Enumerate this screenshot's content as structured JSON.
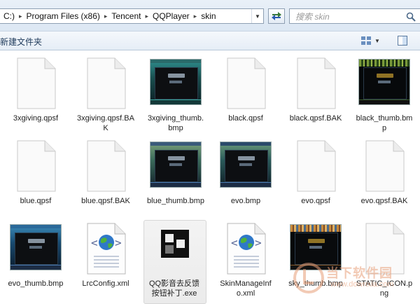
{
  "address": {
    "crumbs": [
      "C:)",
      "Program Files (x86)",
      "Tencent",
      "QQPlayer",
      "skin"
    ],
    "separator": "▸"
  },
  "search": {
    "placeholder": "搜索 skin"
  },
  "toolbar": {
    "new_folder_label": "新建文件夹"
  },
  "files": [
    {
      "name": "3xgiving.qpsf",
      "type": "doc"
    },
    {
      "name": "3xgiving.qpsf.BAK",
      "type": "doc"
    },
    {
      "name": "3xgiving_thumb.bmp",
      "type": "bmp-green"
    },
    {
      "name": "black.qpsf",
      "type": "doc"
    },
    {
      "name": "black.qpsf.BAK",
      "type": "doc"
    },
    {
      "name": "black_thumb.bmp",
      "type": "bmp-black"
    },
    {
      "name": "blue.qpsf",
      "type": "doc"
    },
    {
      "name": "blue.qpsf.BAK",
      "type": "doc"
    },
    {
      "name": "blue_thumb.bmp",
      "type": "bmp-green"
    },
    {
      "name": "evo.bmp",
      "type": "bmp-green"
    },
    {
      "name": "evo.qpsf",
      "type": "doc"
    },
    {
      "name": "evo.qpsf.BAK",
      "type": "doc"
    },
    {
      "name": "evo_thumb.bmp",
      "type": "bmp-blue"
    },
    {
      "name": "LrcConfig.xml",
      "type": "xml"
    },
    {
      "name": "QQ影音去反馈按钮补丁.exe",
      "type": "exe"
    },
    {
      "name": "SkinManageInfo.xml",
      "type": "xml"
    },
    {
      "name": "sky_thumb.bmp",
      "type": "bmp-sky"
    },
    {
      "name": "STATIC_ICON.png",
      "type": "doc"
    }
  ],
  "selected_file": "QQ影音去反馈按钮补丁.exe",
  "watermark": {
    "text": "当下软件园",
    "url": "www.downxia.com"
  },
  "colors": {
    "accent": "#4a7bb2",
    "window_bg": "#ffffff"
  }
}
